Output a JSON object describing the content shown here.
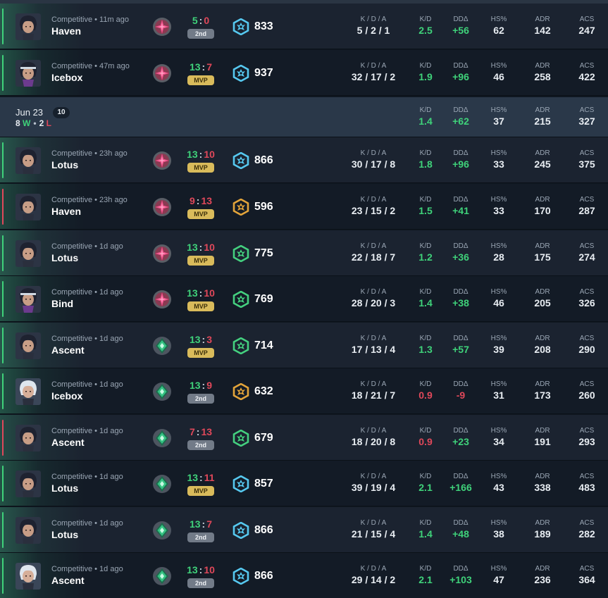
{
  "labels": {
    "kda": "K / D / A",
    "kd": "K/D",
    "dd": "DDΔ",
    "hs": "HS%",
    "adr": "ADR",
    "acs": "ACS"
  },
  "day_header": {
    "date": "Jun 23",
    "count": "10",
    "wins": "8",
    "wins_letter": "W",
    "losses": "2",
    "losses_letter": "L",
    "dot": "•",
    "kd": "1.4",
    "dd": "+62",
    "hs": "37",
    "adr": "215",
    "acs": "327"
  },
  "matches": [
    {
      "mode": "Competitive • 11m ago",
      "map": "Haven",
      "agent": "dark-hair",
      "rank_icon": "radiant-pink",
      "score_us": "5",
      "score_them": "0",
      "result": "win",
      "badge": "2nd",
      "rr_color": "#56c8ef",
      "rr": "833",
      "kda": "5 / 2 / 1",
      "kd": "2.5",
      "kd_sign": "pos",
      "dd": "+56",
      "dd_sign": "pos",
      "hs": "62",
      "adr": "142",
      "acs": "247"
    },
    {
      "mode": "Competitive • 47m ago",
      "map": "Icebox",
      "agent": "headband",
      "rank_icon": "radiant-pink",
      "score_us": "13",
      "score_them": "7",
      "result": "win",
      "badge": "MVP",
      "rr_color": "#56c8ef",
      "rr": "937",
      "kda": "32 / 17 / 2",
      "kd": "1.9",
      "kd_sign": "pos",
      "dd": "+96",
      "dd_sign": "pos",
      "hs": "46",
      "adr": "258",
      "acs": "422"
    },
    {
      "mode": "Competitive • 23h ago",
      "map": "Lotus",
      "agent": "dark-hair",
      "rank_icon": "radiant-pink",
      "score_us": "13",
      "score_them": "10",
      "result": "win",
      "badge": "MVP",
      "rr_color": "#56c8ef",
      "rr": "866",
      "kda": "30 / 17 / 8",
      "kd": "1.8",
      "kd_sign": "pos",
      "dd": "+96",
      "dd_sign": "pos",
      "hs": "33",
      "adr": "245",
      "acs": "375"
    },
    {
      "mode": "Competitive • 23h ago",
      "map": "Haven",
      "agent": "dark-hair",
      "rank_icon": "radiant-pink",
      "score_us": "9",
      "score_them": "13",
      "result": "loss",
      "badge": "MVP",
      "rr_color": "#e3a43a",
      "rr": "596",
      "kda": "23 / 15 / 2",
      "kd": "1.5",
      "kd_sign": "pos",
      "dd": "+41",
      "dd_sign": "pos",
      "hs": "33",
      "adr": "170",
      "acs": "287"
    },
    {
      "mode": "Competitive • 1d ago",
      "map": "Lotus",
      "agent": "dark-hair",
      "rank_icon": "radiant-pink",
      "score_us": "13",
      "score_them": "10",
      "result": "win",
      "badge": "MVP",
      "rr_color": "#44d07f",
      "rr": "775",
      "kda": "22 / 18 / 7",
      "kd": "1.2",
      "kd_sign": "pos",
      "dd": "+36",
      "dd_sign": "pos",
      "hs": "28",
      "adr": "175",
      "acs": "274"
    },
    {
      "mode": "Competitive • 1d ago",
      "map": "Bind",
      "agent": "headband",
      "rank_icon": "radiant-pink",
      "score_us": "13",
      "score_them": "10",
      "result": "win",
      "badge": "MVP",
      "rr_color": "#44d07f",
      "rr": "769",
      "kda": "28 / 20 / 3",
      "kd": "1.4",
      "kd_sign": "pos",
      "dd": "+38",
      "dd_sign": "pos",
      "hs": "46",
      "adr": "205",
      "acs": "326"
    },
    {
      "mode": "Competitive • 1d ago",
      "map": "Ascent",
      "agent": "dark-hair",
      "rank_icon": "ascendant-green",
      "score_us": "13",
      "score_them": "3",
      "result": "win",
      "badge": "MVP",
      "rr_color": "#44d07f",
      "rr": "714",
      "kda": "17 / 13 / 4",
      "kd": "1.3",
      "kd_sign": "pos",
      "dd": "+57",
      "dd_sign": "pos",
      "hs": "39",
      "adr": "208",
      "acs": "290"
    },
    {
      "mode": "Competitive • 1d ago",
      "map": "Icebox",
      "agent": "white-hair",
      "rank_icon": "ascendant-green",
      "score_us": "13",
      "score_them": "9",
      "result": "win",
      "badge": "2nd",
      "rr_color": "#e3a43a",
      "rr": "632",
      "kda": "18 / 21 / 7",
      "kd": "0.9",
      "kd_sign": "neg",
      "dd": "-9",
      "dd_sign": "neg",
      "hs": "31",
      "adr": "173",
      "acs": "260"
    },
    {
      "mode": "Competitive • 1d ago",
      "map": "Ascent",
      "agent": "dark-hair",
      "rank_icon": "ascendant-green",
      "score_us": "7",
      "score_them": "13",
      "result": "loss",
      "badge": "2nd",
      "rr_color": "#44d07f",
      "rr": "679",
      "kda": "18 / 20 / 8",
      "kd": "0.9",
      "kd_sign": "neg",
      "dd": "+23",
      "dd_sign": "pos",
      "hs": "34",
      "adr": "191",
      "acs": "293"
    },
    {
      "mode": "Competitive • 1d ago",
      "map": "Lotus",
      "agent": "dark-hair",
      "rank_icon": "ascendant-green",
      "score_us": "13",
      "score_them": "11",
      "result": "win",
      "badge": "MVP",
      "rr_color": "#56c8ef",
      "rr": "857",
      "kda": "39 / 19 / 4",
      "kd": "2.1",
      "kd_sign": "pos",
      "dd": "+166",
      "dd_sign": "pos",
      "hs": "43",
      "adr": "338",
      "acs": "483"
    },
    {
      "mode": "Competitive • 1d ago",
      "map": "Lotus",
      "agent": "dark-hair",
      "rank_icon": "ascendant-green",
      "score_us": "13",
      "score_them": "7",
      "result": "win",
      "badge": "2nd",
      "rr_color": "#56c8ef",
      "rr": "866",
      "kda": "21 / 15 / 4",
      "kd": "1.4",
      "kd_sign": "pos",
      "dd": "+48",
      "dd_sign": "pos",
      "hs": "38",
      "adr": "189",
      "acs": "282"
    },
    {
      "mode": "Competitive • 1d ago",
      "map": "Ascent",
      "agent": "white-hair",
      "rank_icon": "ascendant-green",
      "score_us": "13",
      "score_them": "10",
      "result": "win",
      "badge": "2nd",
      "rr_color": "#56c8ef",
      "rr": "866",
      "kda": "29 / 14 / 2",
      "kd": "2.1",
      "kd_sign": "pos",
      "dd": "+103",
      "dd_sign": "pos",
      "hs": "47",
      "adr": "236",
      "acs": "364"
    }
  ]
}
